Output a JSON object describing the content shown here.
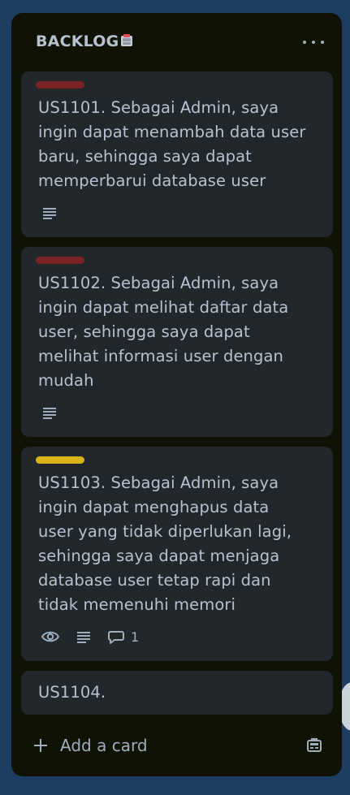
{
  "list": {
    "title": "BACKLOG",
    "title_emoji_icon": "file-cabinet-emoji",
    "more_icon": "more-horizontal-icon",
    "add_card_label": "Add a card",
    "add_icon": "plus-icon",
    "template_icon": "card-template-icon"
  },
  "cards": [
    {
      "label_color": "#7a2224",
      "title": "US1101. Sebagai Admin, saya ingin dapat menambah data user baru, sehingga saya dapat memperbarui database user",
      "has_description": true
    },
    {
      "label_color": "#7a2224",
      "title": "US1102. Sebagai Admin, saya ingin dapat melihat daftar data user, sehingga saya dapat melihat informasi user dengan mudah",
      "has_description": true
    },
    {
      "label_color": "#d8b41a",
      "title": "US1103. Sebagai Admin, saya ingin dapat menghapus data user yang tidak diperlukan lagi, sehingga saya dapat menjaga database user tetap rapi dan tidak memenuhi memori",
      "watching": true,
      "has_description": true,
      "comment_count": "1"
    },
    {
      "title": "US1104."
    }
  ],
  "colors": {
    "board_background": "#1d3d63",
    "list_background": "#101204",
    "card_background": "#22272b",
    "text": "#b6c2cf",
    "muted_text": "#9fadbc"
  }
}
